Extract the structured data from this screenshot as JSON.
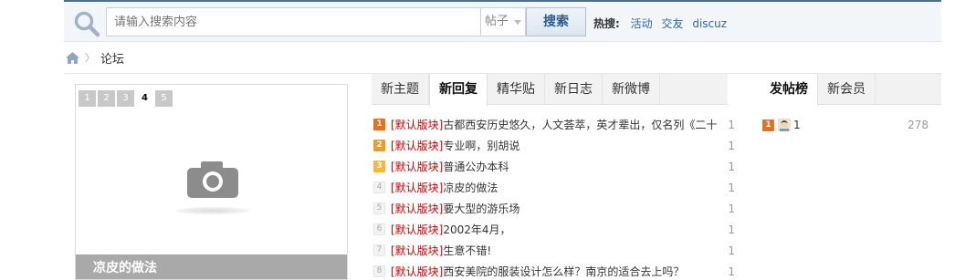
{
  "search": {
    "placeholder": "请输入搜索内容",
    "type_label": "帖子",
    "button_label": "搜索",
    "hot_label": "热搜:",
    "hot_links": [
      "活动",
      "交友",
      "discuz"
    ]
  },
  "breadcrumb": {
    "current": "论坛"
  },
  "slideshow": {
    "pages": [
      "1",
      "2",
      "3",
      "4",
      "5"
    ],
    "current_page": "4",
    "caption": "凉皮的做法"
  },
  "thread_tabs": [
    "新主题",
    "新回复",
    "精华贴",
    "新日志",
    "新微博"
  ],
  "thread_tabs_active": "新回复",
  "threads": [
    {
      "rank": "1",
      "forum": "[默认版块]",
      "title": "古都西安历史悠久，人文荟萃，英才辈出，仅名列《二十",
      "count": "1"
    },
    {
      "rank": "2",
      "forum": "[默认版块]",
      "title": "专业啊，别胡说",
      "count": "1"
    },
    {
      "rank": "3",
      "forum": "[默认版块]",
      "title": "普通公办本科",
      "count": "1"
    },
    {
      "rank": "4",
      "forum": "[默认版块]",
      "title": "凉皮的做法",
      "count": "1"
    },
    {
      "rank": "5",
      "forum": "[默认版块]",
      "title": "要大型的游乐场",
      "count": "1"
    },
    {
      "rank": "6",
      "forum": "[默认版块]",
      "title": "2002年4月，",
      "count": "1"
    },
    {
      "rank": "7",
      "forum": "[默认版块]",
      "title": "生意不错!",
      "count": "1"
    },
    {
      "rank": "8",
      "forum": "[默认版块]",
      "title": "西安美院的服装设计怎么样？南京的适合去上吗？",
      "count": "1"
    }
  ],
  "member_tabs": [
    "发帖榜",
    "新会员"
  ],
  "member_tabs_active": "发帖榜",
  "top_posters": [
    {
      "rank": "1",
      "name": "1",
      "count": "278"
    }
  ],
  "colors": {
    "rank_1": "#e76f1d",
    "rank_2": "#f19c21",
    "rank_3": "#f6b73e",
    "forum_tag": "#cc0000",
    "link": "#336699"
  },
  "icons": [
    "search-icon",
    "home-icon",
    "camera-icon",
    "avatar-icon"
  ]
}
